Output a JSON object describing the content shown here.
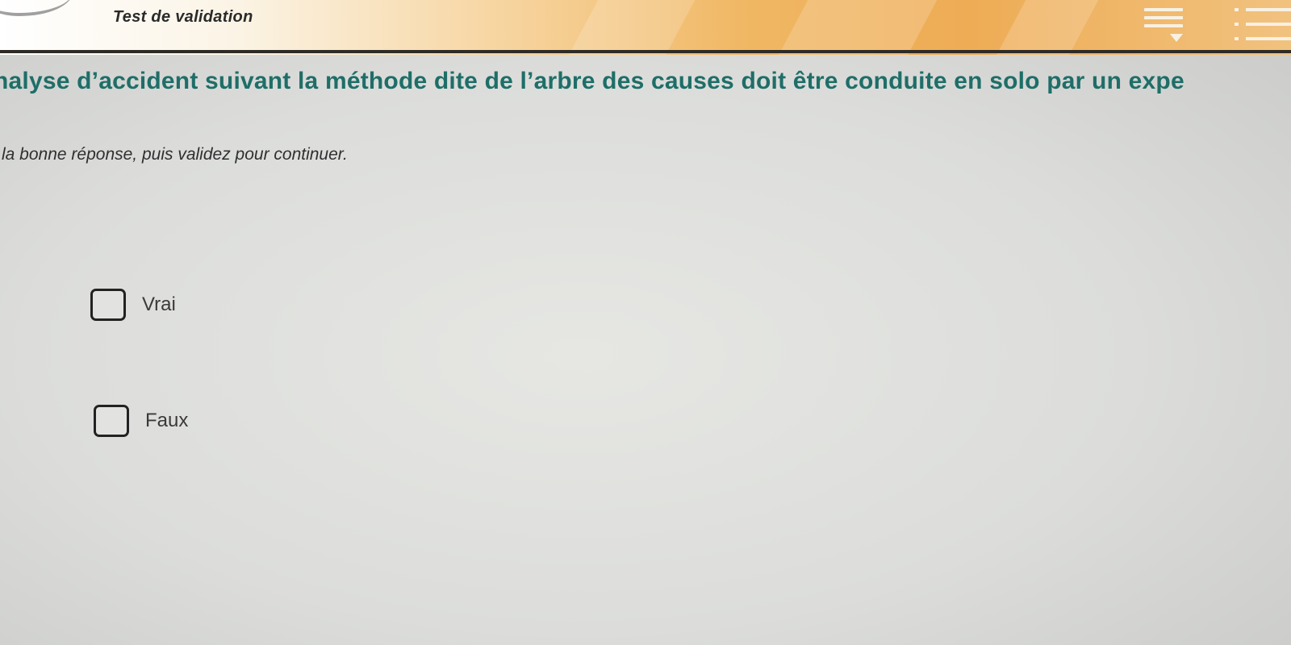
{
  "header": {
    "title": "Test de validation",
    "notes_icon": "notes-icon",
    "menu_icon": "list-menu-icon",
    "accent_color": "#f0b763"
  },
  "question": {
    "text": "nalyse d’accident suivant la méthode dite de l’arbre des causes doit être conduite en solo par un expe",
    "color": "#1f6e68"
  },
  "instruction": "la bonne réponse, puis validez pour continuer.",
  "options": [
    {
      "label": "Vrai",
      "checked": false
    },
    {
      "label": "Faux",
      "checked": false
    }
  ]
}
